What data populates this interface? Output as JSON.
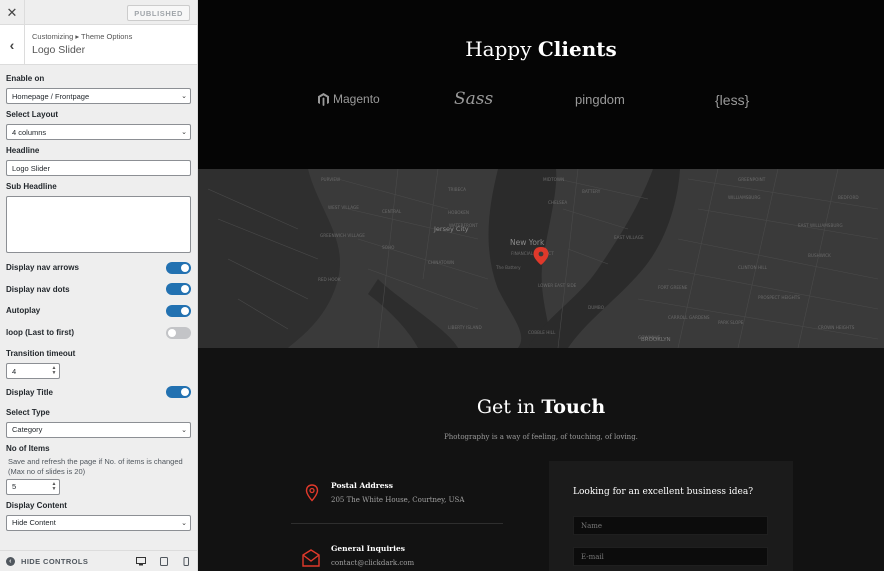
{
  "customizer": {
    "close_glyph": "✕",
    "publish_label": "PUBLISHED",
    "breadcrumb": "Customizing ▸ Theme Options",
    "section_title": "Logo Slider",
    "enable_on": {
      "label": "Enable on",
      "value": "Homepage / Frontpage"
    },
    "select_layout": {
      "label": "Select Layout",
      "value": "4 columns"
    },
    "headline": {
      "label": "Headline",
      "value": "Logo Slider"
    },
    "sub_headline": {
      "label": "Sub Headline",
      "value": ""
    },
    "toggles": [
      {
        "label": "Display nav arrows",
        "on": true
      },
      {
        "label": "Display nav dots",
        "on": true
      },
      {
        "label": "Autoplay",
        "on": true
      },
      {
        "label": "loop (Last to first)",
        "on": false
      }
    ],
    "transition_timeout": {
      "label": "Transition timeout",
      "value": "4"
    },
    "display_title": {
      "label": "Display Title",
      "on": true
    },
    "select_type": {
      "label": "Select Type",
      "value": "Category"
    },
    "no_of_items": {
      "label": "No of Items",
      "help": "Save and refresh the page if No. of items is changed (Max no of slides is 20)",
      "value": "5"
    },
    "display_content": {
      "label": "Display Content",
      "value": "Hide Content"
    },
    "footer": {
      "hide_controls": "HIDE CONTROLS"
    },
    "accent_color": "#2271b1"
  },
  "preview": {
    "clients": {
      "title_regular": "Happy ",
      "title_bold": "Clients",
      "logos": [
        "Magento",
        "Sass",
        "pingdom",
        "{less}"
      ]
    },
    "map": {
      "labels": [
        "New York",
        "Jersey City",
        "BROOKLYN",
        "PURVIEW",
        "WATERFRONT",
        "CENTRAL",
        "HOBOKEN",
        "MIDTOWN",
        "CHELSEA",
        "GREENWICH VILLAGE",
        "SOHO",
        "CHINATOWN",
        "BATTERY",
        "EAST VILLAGE",
        "LOWER EAST SIDE",
        "WILLIAMSBURG",
        "EAST WILLIAMSBURG",
        "BUSHWICK",
        "GREENPOINT",
        "DUMBO",
        "FORT GREENE",
        "PARK SLOPE",
        "RED HOOK",
        "CARROLL GARDENS",
        "PROSPECT HEIGHTS",
        "CROWN HEIGHTS",
        "BEDFORD",
        "CLINTON HILL",
        "GOWANUS",
        "COBBLE HILL",
        "WEST VILLAGE",
        "TRIBECA",
        "FINANCIAL DISTRICT",
        "The Battery",
        "LIBERTY ISLAND"
      ],
      "pin_color": "#e0392b"
    },
    "touch": {
      "title_regular": "Get in ",
      "title_bold": "Touch",
      "subtitle": "Photography is a way of feeling, of touching, of loving.",
      "address_title": "Postal Address",
      "address_text": "205 The White House, Courtney, USA",
      "inquiries_title": "General Inquiries",
      "inquiries_text": "contact@clickdark.com",
      "form_title": "Looking for an excellent business idea?",
      "name_placeholder": "Name",
      "email_placeholder": "E-mail",
      "icon_color": "#e0392b"
    }
  }
}
